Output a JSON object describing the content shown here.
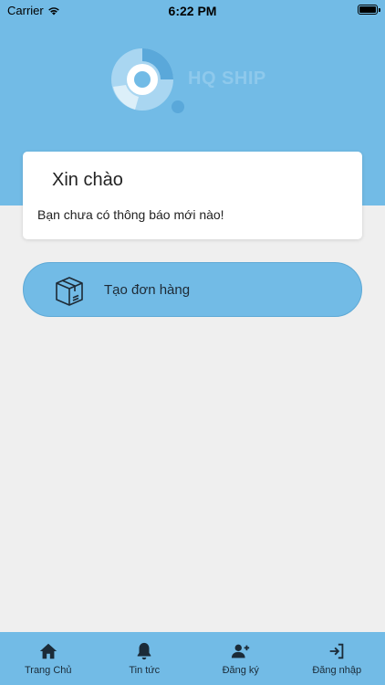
{
  "status_bar": {
    "carrier": "Carrier",
    "time": "6:22 PM"
  },
  "brand": {
    "name": "HQ SHIP"
  },
  "greeting": {
    "title": "Xin chào",
    "message": "Bạn chưa có thông báo mới nào!"
  },
  "actions": {
    "create_order": "Tạo đơn hàng"
  },
  "tabs": [
    {
      "label": "Trang Chủ",
      "icon": "home-icon"
    },
    {
      "label": "Tin tức",
      "icon": "bell-icon"
    },
    {
      "label": "Đăng ký",
      "icon": "add-user-icon"
    },
    {
      "label": "Đăng nhập",
      "icon": "login-icon"
    }
  ],
  "colors": {
    "primary": "#72bbe6",
    "background": "#efefef",
    "card": "#ffffff"
  }
}
